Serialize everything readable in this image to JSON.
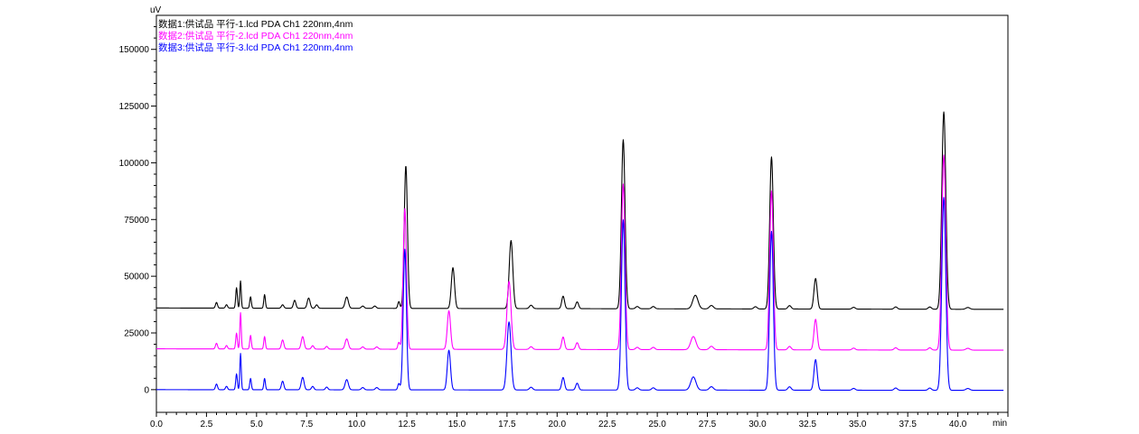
{
  "chart_data": {
    "type": "line",
    "ylabel": "uV",
    "xlabel": "min",
    "xlim": [
      0,
      42.5
    ],
    "ylim": [
      -10000,
      165000
    ],
    "x_ticks": [
      "0.0",
      "2.5",
      "5.0",
      "7.5",
      "10.0",
      "12.5",
      "15.0",
      "17.5",
      "20.0",
      "22.5",
      "25.0",
      "27.5",
      "30.0",
      "32.5",
      "35.0",
      "37.5",
      "40.0"
    ],
    "y_ticks": [
      "0",
      "25000",
      "50000",
      "75000",
      "100000",
      "125000",
      "150000"
    ],
    "grid": false,
    "legend_position": "top-left",
    "series": [
      {
        "name": "数据1:供试品 平行-1.lcd PDA Ch1 220nm,4nm",
        "color": "#000000",
        "baseline": 36000,
        "peaks": [
          [
            3.0,
            2500,
            0.05
          ],
          [
            3.5,
            1500,
            0.05
          ],
          [
            4.0,
            9000,
            0.04
          ],
          [
            4.2,
            12000,
            0.035
          ],
          [
            4.7,
            5000,
            0.04
          ],
          [
            5.4,
            6000,
            0.04
          ],
          [
            6.3,
            1500,
            0.06
          ],
          [
            6.9,
            3500,
            0.06
          ],
          [
            7.6,
            4500,
            0.07
          ],
          [
            8.0,
            1500,
            0.06
          ],
          [
            9.5,
            5000,
            0.08
          ],
          [
            10.3,
            1000,
            0.07
          ],
          [
            10.9,
            1000,
            0.07
          ],
          [
            12.1,
            3000,
            0.05
          ],
          [
            12.45,
            63000,
            0.08
          ],
          [
            14.8,
            18000,
            0.08
          ],
          [
            17.7,
            30000,
            0.09
          ],
          [
            18.7,
            1500,
            0.08
          ],
          [
            20.3,
            5500,
            0.07
          ],
          [
            21.0,
            3000,
            0.07
          ],
          [
            23.3,
            74500,
            0.09
          ],
          [
            24.0,
            1000,
            0.08
          ],
          [
            24.8,
            1000,
            0.08
          ],
          [
            26.9,
            6000,
            0.13
          ],
          [
            27.7,
            1500,
            0.1
          ],
          [
            29.9,
            1000,
            0.08
          ],
          [
            30.7,
            67000,
            0.09
          ],
          [
            31.6,
            1500,
            0.08
          ],
          [
            32.9,
            13500,
            0.08
          ],
          [
            34.8,
            800,
            0.08
          ],
          [
            36.9,
            1000,
            0.08
          ],
          [
            38.6,
            1000,
            0.08
          ],
          [
            39.3,
            87000,
            0.1
          ],
          [
            40.5,
            800,
            0.1
          ]
        ],
        "drift": -600
      },
      {
        "name": "数据2:供试品 平行-2.lcd PDA Ch1 220nm,4nm",
        "color": "#ff00ff",
        "baseline": 18000,
        "peaks": [
          [
            3.0,
            2500,
            0.05
          ],
          [
            3.5,
            1500,
            0.05
          ],
          [
            4.0,
            7000,
            0.04
          ],
          [
            4.2,
            16000,
            0.035
          ],
          [
            4.7,
            6000,
            0.04
          ],
          [
            5.4,
            5500,
            0.04
          ],
          [
            6.3,
            4000,
            0.06
          ],
          [
            7.3,
            5500,
            0.07
          ],
          [
            7.8,
            1500,
            0.06
          ],
          [
            8.5,
            1200,
            0.06
          ],
          [
            9.5,
            4500,
            0.08
          ],
          [
            10.3,
            1000,
            0.07
          ],
          [
            11.0,
            1000,
            0.07
          ],
          [
            12.1,
            3000,
            0.05
          ],
          [
            12.4,
            62000,
            0.08
          ],
          [
            14.6,
            17000,
            0.08
          ],
          [
            17.6,
            30000,
            0.1
          ],
          [
            18.7,
            1200,
            0.08
          ],
          [
            20.3,
            5500,
            0.07
          ],
          [
            21.0,
            3000,
            0.07
          ],
          [
            23.3,
            73000,
            0.09
          ],
          [
            24.0,
            1000,
            0.08
          ],
          [
            24.8,
            1000,
            0.08
          ],
          [
            26.8,
            5800,
            0.13
          ],
          [
            27.7,
            1500,
            0.1
          ],
          [
            30.7,
            70000,
            0.09
          ],
          [
            31.6,
            1500,
            0.08
          ],
          [
            32.9,
            13500,
            0.08
          ],
          [
            34.8,
            800,
            0.08
          ],
          [
            36.9,
            1000,
            0.08
          ],
          [
            38.6,
            1000,
            0.08
          ],
          [
            39.3,
            86000,
            0.1
          ],
          [
            40.5,
            800,
            0.1
          ]
        ],
        "drift": -600
      },
      {
        "name": "数据3:供试品 平行-3.lcd PDA Ch1 220nm,4nm",
        "color": "#0000ff",
        "baseline": 0,
        "peaks": [
          [
            3.0,
            2500,
            0.05
          ],
          [
            3.5,
            1500,
            0.05
          ],
          [
            4.0,
            7000,
            0.04
          ],
          [
            4.2,
            16000,
            0.035
          ],
          [
            4.7,
            5000,
            0.04
          ],
          [
            5.4,
            5000,
            0.04
          ],
          [
            6.3,
            3800,
            0.06
          ],
          [
            7.3,
            5500,
            0.07
          ],
          [
            7.8,
            1500,
            0.06
          ],
          [
            8.5,
            1200,
            0.06
          ],
          [
            9.5,
            4500,
            0.08
          ],
          [
            10.3,
            1000,
            0.07
          ],
          [
            11.0,
            1000,
            0.07
          ],
          [
            12.1,
            2800,
            0.05
          ],
          [
            12.4,
            62000,
            0.08
          ],
          [
            14.6,
            17500,
            0.08
          ],
          [
            17.6,
            30000,
            0.1
          ],
          [
            18.7,
            1200,
            0.08
          ],
          [
            20.3,
            5500,
            0.07
          ],
          [
            21.0,
            3000,
            0.07
          ],
          [
            23.3,
            75000,
            0.09
          ],
          [
            24.0,
            1000,
            0.08
          ],
          [
            24.8,
            1000,
            0.08
          ],
          [
            26.8,
            5800,
            0.13
          ],
          [
            27.7,
            1500,
            0.1
          ],
          [
            30.7,
            70000,
            0.09
          ],
          [
            31.6,
            1500,
            0.08
          ],
          [
            32.9,
            13500,
            0.08
          ],
          [
            34.8,
            800,
            0.08
          ],
          [
            36.9,
            1000,
            0.08
          ],
          [
            38.6,
            1000,
            0.08
          ],
          [
            39.3,
            85000,
            0.1
          ],
          [
            40.5,
            800,
            0.1
          ]
        ],
        "drift": -300
      }
    ]
  }
}
